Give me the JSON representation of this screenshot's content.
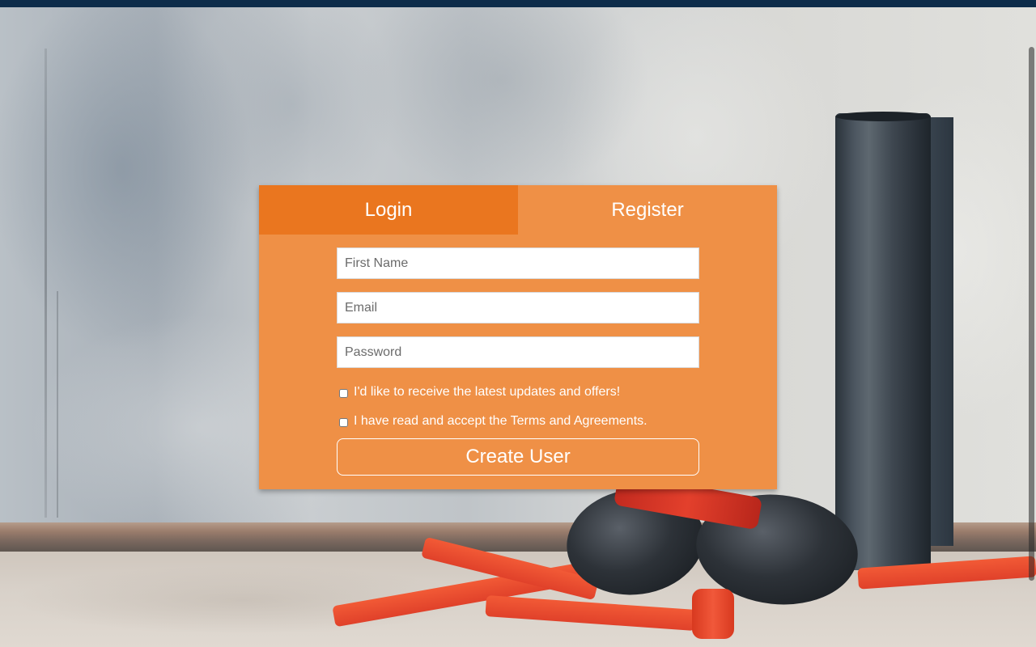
{
  "tabs": {
    "login_label": "Login",
    "register_label": "Register"
  },
  "form": {
    "first_name": {
      "placeholder": "First Name",
      "value": ""
    },
    "email": {
      "placeholder": "Email",
      "value": ""
    },
    "password": {
      "placeholder": "Password",
      "value": ""
    },
    "updates_checkbox": {
      "label": "I'd like to receive the latest updates and offers!",
      "checked": false
    },
    "terms_checkbox": {
      "label": "I have read and accept the Terms and Agreements.",
      "checked": false
    },
    "submit_label": "Create User"
  },
  "colors": {
    "card_bg": "#ef9046",
    "active_tab_bg": "#ea761f",
    "top_bar": "#0d2c4a"
  }
}
